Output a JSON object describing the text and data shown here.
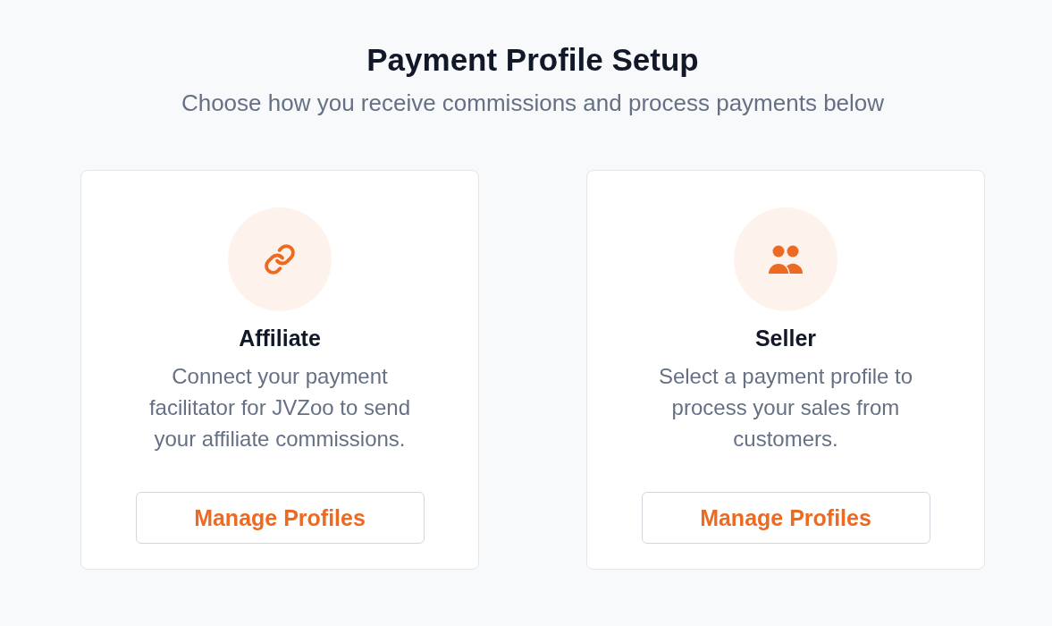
{
  "header": {
    "title": "Payment Profile Setup",
    "subtitle": "Choose how you receive commissions and process payments below"
  },
  "cards": [
    {
      "kind": "affiliate",
      "title": "Affiliate",
      "description": "Connect your payment facilitator for JVZoo to send your affiliate commissions.",
      "button": "Manage Profiles"
    },
    {
      "kind": "seller",
      "title": "Seller",
      "description": "Select a payment profile to process your sales from customers.",
      "button": "Manage Profiles"
    }
  ]
}
